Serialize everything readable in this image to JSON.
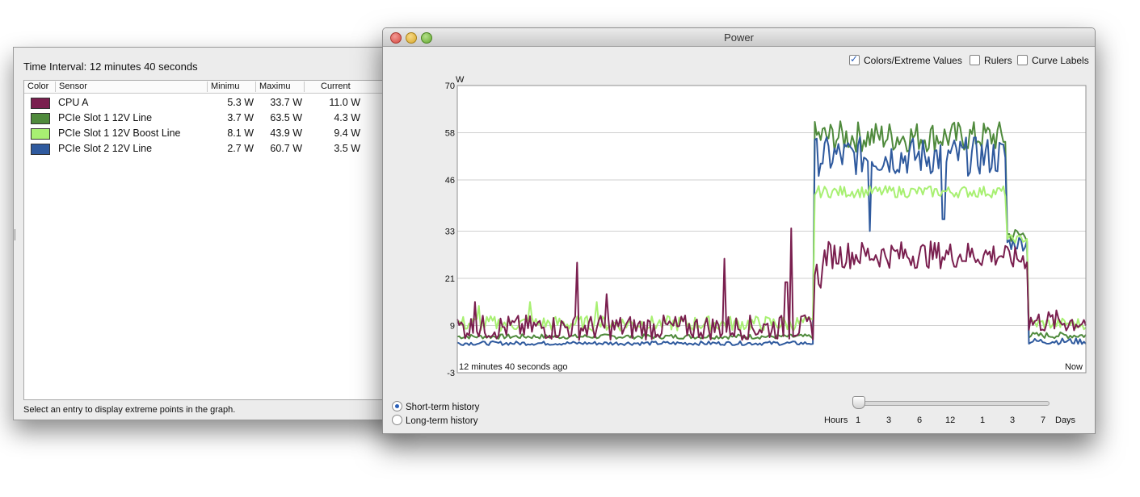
{
  "sensor_window": {
    "time_interval": "Time Interval: 12 minutes 40 seconds",
    "columns": [
      "Color",
      "Sensor",
      "Minimu",
      "Maximu",
      "Current"
    ],
    "rows": [
      {
        "name": "CPU A",
        "min": "5.3 W",
        "max": "33.7 W",
        "current": "11.0 W",
        "color": "#7a1f4f"
      },
      {
        "name": "PCIe Slot 1 12V Line",
        "min": "3.7 W",
        "max": "63.5 W",
        "current": "4.3 W",
        "color": "#4f8a3c"
      },
      {
        "name": "PCIe Slot 1 12V Boost Line",
        "min": "8.1 W",
        "max": "43.9 W",
        "current": "9.4 W",
        "color": "#a8f072"
      },
      {
        "name": "PCIe Slot 2 12V Line",
        "min": "2.7 W",
        "max": "60.7 W",
        "current": "3.5 W",
        "color": "#2f5a9e"
      }
    ],
    "status": "Select an entry to display extreme points in the graph."
  },
  "power_window": {
    "title": "Power",
    "checkboxes": [
      {
        "label": "Colors/Extreme Values",
        "checked": true
      },
      {
        "label": "Rulers",
        "checked": false
      },
      {
        "label": "Curve Labels",
        "checked": false
      }
    ],
    "history": {
      "short": "Short-term history",
      "long": "Long-term history",
      "selected": "short"
    },
    "slider": {
      "start_label": "Hours",
      "ticks": [
        "1",
        "3",
        "6",
        "12",
        "1",
        "3",
        "7"
      ],
      "end_label": "Days"
    }
  },
  "chart_data": {
    "type": "line",
    "unit": "W",
    "ylim": [
      -3,
      70
    ],
    "yticks": [
      -3,
      9,
      21,
      33,
      46,
      58,
      70
    ],
    "x_start_label": "12 minutes 40 seconds ago",
    "x_end_label": "Now",
    "grid": true,
    "series": [
      {
        "name": "CPU A",
        "color": "#7a1f4f",
        "segments": [
          {
            "t0": 0,
            "t1": 0.975,
            "base": 8.5,
            "amp": 3.2,
            "spikes": [
              [
                0.05,
                15
              ],
              [
                0.33,
                25
              ],
              [
                0.41,
                17
              ],
              [
                0.73,
                26
              ],
              [
                0.9,
                20
              ],
              [
                0.915,
                33.7
              ]
            ]
          },
          {
            "t0": 0.975,
            "t1": 1.0,
            "base": 22,
            "amp": 4
          },
          {
            "t0": 1.0,
            "t1": 1.5,
            "base": 27,
            "amp": 3.5
          },
          {
            "t0": 1.5,
            "t1": 1.56,
            "base": 26,
            "amp": 3
          },
          {
            "t0": 1.56,
            "t1": 1.72,
            "base": 10,
            "amp": 3
          }
        ]
      },
      {
        "name": "PCIe Slot 1 12V Line",
        "color": "#4f8a3c",
        "segments": [
          {
            "t0": 0,
            "t1": 0.975,
            "base": 6.2,
            "amp": 0.6
          },
          {
            "t0": 0.975,
            "t1": 1.5,
            "base": 57,
            "amp": 4
          },
          {
            "t0": 1.5,
            "t1": 1.56,
            "base": 32,
            "amp": 2
          },
          {
            "t0": 1.56,
            "t1": 1.72,
            "base": 6.5,
            "amp": 0.8
          }
        ]
      },
      {
        "name": "PCIe Slot 1 12V Boost Line",
        "color": "#a8f072",
        "segments": [
          {
            "t0": 0,
            "t1": 0.975,
            "base": 9.5,
            "amp": 2.0,
            "spikes": [
              [
                0.06,
                14
              ],
              [
                0.2,
                15
              ],
              [
                0.38,
                15
              ]
            ]
          },
          {
            "t0": 0.975,
            "t1": 1.5,
            "base": 43,
            "amp": 1.5
          },
          {
            "t0": 1.5,
            "t1": 1.56,
            "base": 31,
            "amp": 1
          },
          {
            "t0": 1.56,
            "t1": 1.72,
            "base": 9.5,
            "amp": 1.5
          }
        ]
      },
      {
        "name": "PCIe Slot 2 12V Line",
        "color": "#2f5a9e",
        "segments": [
          {
            "t0": 0,
            "t1": 0.975,
            "base": 4.5,
            "amp": 0.5
          },
          {
            "t0": 0.975,
            "t1": 1.5,
            "base": 52,
            "amp": 5,
            "spikes": [
              [
                1.13,
                33
              ],
              [
                1.33,
                36
              ]
            ]
          },
          {
            "t0": 1.5,
            "t1": 1.56,
            "base": 30,
            "amp": 2
          },
          {
            "t0": 1.56,
            "t1": 1.72,
            "base": 5,
            "amp": 0.8
          }
        ]
      }
    ]
  }
}
